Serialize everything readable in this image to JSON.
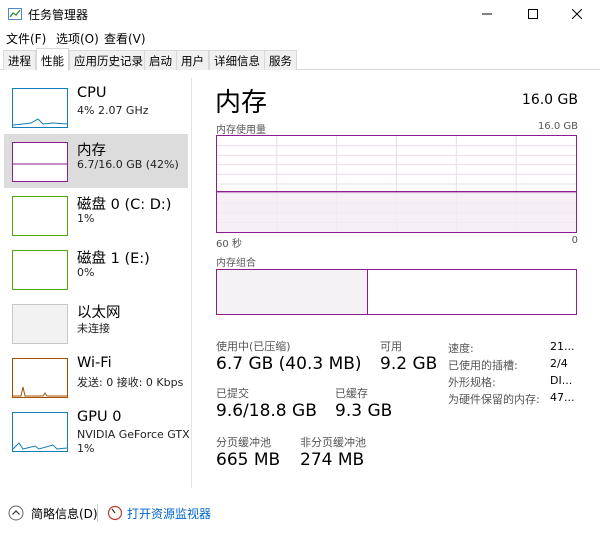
{
  "window": {
    "title": "任务管理器"
  },
  "menu": [
    "文件(F)",
    "选项(O)",
    "查看(V)"
  ],
  "tabs": [
    "进程",
    "性能",
    "应用历史记录",
    "启动",
    "用户",
    "详细信息",
    "服务"
  ],
  "active_tab": "性能",
  "sidebar": [
    {
      "name": "CPU",
      "sub": "4%  2.07 GHz",
      "color": "#117dbb"
    },
    {
      "name": "内存",
      "sub": "6.7/16.0 GB (42%)",
      "color": "#8b1e8b",
      "selected": true
    },
    {
      "name": "磁盘 0 (C: D:)",
      "sub": "1%",
      "color": "#4da60c"
    },
    {
      "name": "磁盘 1 (E:)",
      "sub": "0%",
      "color": "#4da60c"
    },
    {
      "name": "以太网",
      "sub": "未连接",
      "color": "#c8c8c8"
    },
    {
      "name": "Wi-Fi",
      "sub": "发送: 0 接收: 0 Kbps",
      "color": "#a74f01"
    },
    {
      "name": "GPU 0",
      "sub": "NVIDIA GeForce GTX",
      "sub2": "1%",
      "color": "#117dbb"
    }
  ],
  "main": {
    "heading": "内存",
    "capacity": "16.0 GB",
    "usage_label": "内存使用量",
    "usage_max": "16.0 GB",
    "x_left": "60 秒",
    "x_right": "0",
    "composition_label": "内存组合",
    "used_fraction": 0.42,
    "stats": {
      "in_use_label": "使用中(已压缩)",
      "in_use_value": "6.7 GB (40.3 MB)",
      "available_label": "可用",
      "available_value": "9.2 GB",
      "committed_label": "已提交",
      "committed_value": "9.6/18.8 GB",
      "cached_label": "已缓存",
      "cached_value": "9.3 GB",
      "paged_label": "分页缓冲池",
      "paged_value": "665 MB",
      "nonpaged_label": "非分页缓冲池",
      "nonpaged_value": "274 MB"
    },
    "details": [
      {
        "label": "速度:",
        "value": "21..."
      },
      {
        "label": "已使用的插槽:",
        "value": "2/4"
      },
      {
        "label": "外形规格:",
        "value": "DI..."
      },
      {
        "label": "为硬件保留的内存:",
        "value": "47..."
      }
    ]
  },
  "footer": {
    "summary": "简略信息(D)",
    "resource_monitor": "打开资源监视器"
  }
}
